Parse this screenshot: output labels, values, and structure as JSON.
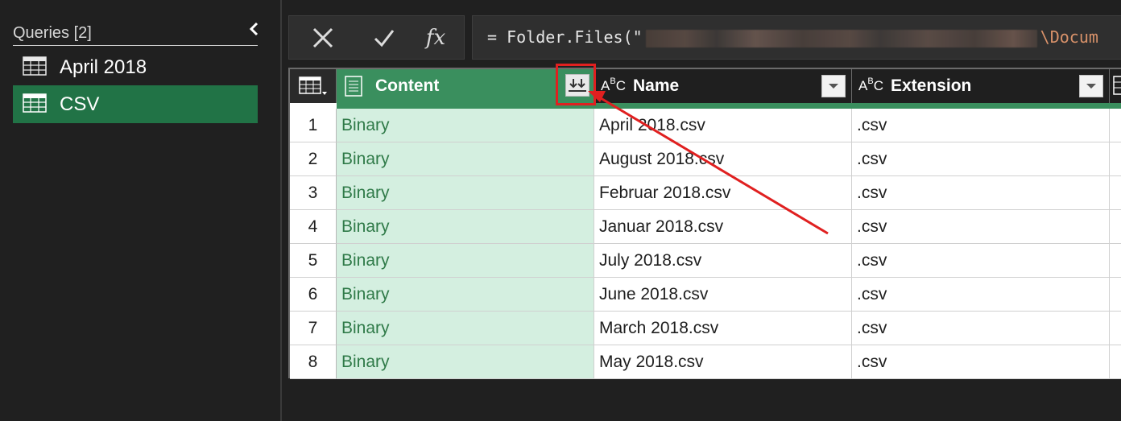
{
  "sidebar": {
    "title": "Queries [2]",
    "items": [
      {
        "label": "April 2018",
        "selected": false
      },
      {
        "label": "CSV",
        "selected": true
      }
    ]
  },
  "formula": {
    "prefix": "= Folder.Files(\"",
    "suffix": "\\Docum"
  },
  "grid": {
    "columns": [
      {
        "label": "Content",
        "type_icon": "table-column-icon"
      },
      {
        "label": "Name",
        "type_icon": "abc-text-type-icon"
      },
      {
        "label": "Extension",
        "type_icon": "abc-text-type-icon"
      }
    ],
    "rows": [
      {
        "n": "1",
        "content": "Binary",
        "name": "April 2018.csv",
        "ext": ".csv"
      },
      {
        "n": "2",
        "content": "Binary",
        "name": "August 2018.csv",
        "ext": ".csv"
      },
      {
        "n": "3",
        "content": "Binary",
        "name": "Februar 2018.csv",
        "ext": ".csv"
      },
      {
        "n": "4",
        "content": "Binary",
        "name": "Januar 2018.csv",
        "ext": ".csv"
      },
      {
        "n": "5",
        "content": "Binary",
        "name": "July 2018.csv",
        "ext": ".csv"
      },
      {
        "n": "6",
        "content": "Binary",
        "name": "June 2018.csv",
        "ext": ".csv"
      },
      {
        "n": "7",
        "content": "Binary",
        "name": "March 2018.csv",
        "ext": ".csv"
      },
      {
        "n": "8",
        "content": "Binary",
        "name": "May 2018.csv",
        "ext": ".csv"
      }
    ]
  },
  "colors": {
    "accent": "#217346",
    "content_header": "#3a8f5e",
    "binary_text": "#2f7a48",
    "annotation": "#e02020"
  }
}
